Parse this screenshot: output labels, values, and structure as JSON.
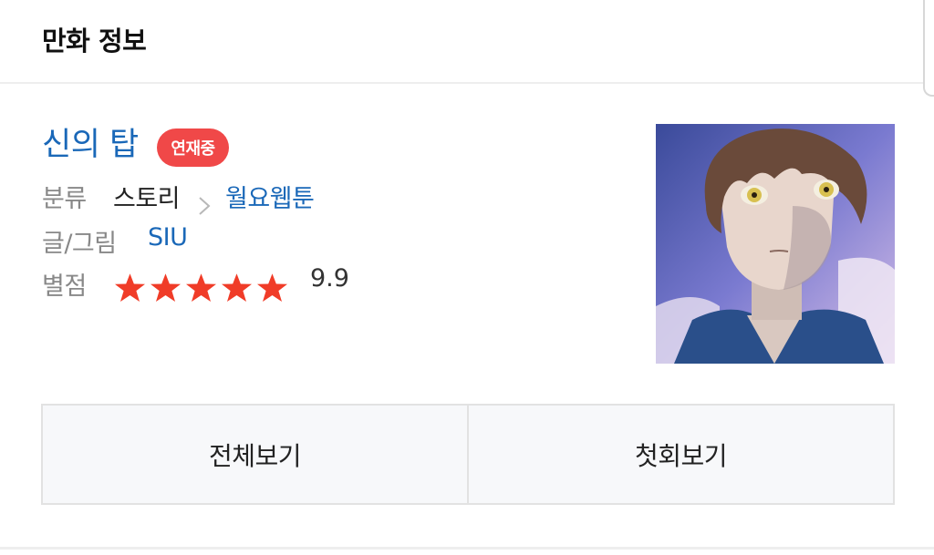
{
  "header": {
    "title": "만화 정보"
  },
  "comic": {
    "title": "신의 탑",
    "status_badge": "연재중",
    "category_label": "분류",
    "category_value": "스토리",
    "subcategory": "월요웹툰",
    "author_label": "글/그림",
    "author": "SIU",
    "rating_label": "별점",
    "rating": "9.9",
    "stars": 5
  },
  "buttons": {
    "view_all": "전체보기",
    "first_episode": "첫회보기"
  },
  "colors": {
    "accent_blue": "#1a68b8",
    "badge_red": "#f04848",
    "star_red": "#f03c28"
  },
  "icons": {
    "chevron": "chevron-right-icon",
    "star": "star-icon"
  }
}
